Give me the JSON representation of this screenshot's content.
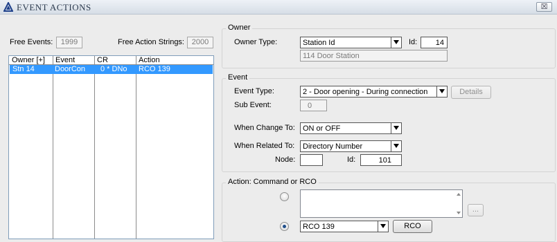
{
  "window": {
    "title": "EVENT ACTIONS",
    "close_glyph": "☒",
    "icon": "triangle-logo-icon"
  },
  "left": {
    "free_events_label": "Free Events:",
    "free_events_value": "1999",
    "free_action_strings_label": "Free Action Strings:",
    "free_action_strings_value": "2000",
    "columns": [
      "Owner [+]",
      "Event",
      "CR",
      "Action"
    ],
    "rows": [
      {
        "owner": "Stn 14",
        "event": "DoorCon",
        "cr": "0 * DNo",
        "action": "RCO 139",
        "selected": true
      }
    ]
  },
  "owner": {
    "group_title": "Owner",
    "type_label": "Owner Type:",
    "type_value": "Station Id",
    "id_label": "Id:",
    "id_value": "14",
    "description": "114 Door Station"
  },
  "event": {
    "group_title": "Event",
    "type_label": "Event Type:",
    "type_value": "2 - Door opening - During connection",
    "details_label": "Details",
    "sub_event_label": "Sub Event:",
    "sub_event_value": "0",
    "when_change_label": "When Change To:",
    "when_change_value": "ON or OFF",
    "when_related_label": "When Related To:",
    "when_related_value": "Directory Number",
    "node_label": "Node:",
    "node_value": "",
    "id_label": "Id:",
    "id_value": "101"
  },
  "action": {
    "group_title": "Action: Command or RCO",
    "command_text": "",
    "ellipsis_label": "...",
    "rco_value": "RCO 139",
    "rco_button_label": "RCO",
    "selected_option": "rco"
  },
  "colors": {
    "selection": "#3399ff",
    "radio_dot": "#1f4e8a"
  }
}
